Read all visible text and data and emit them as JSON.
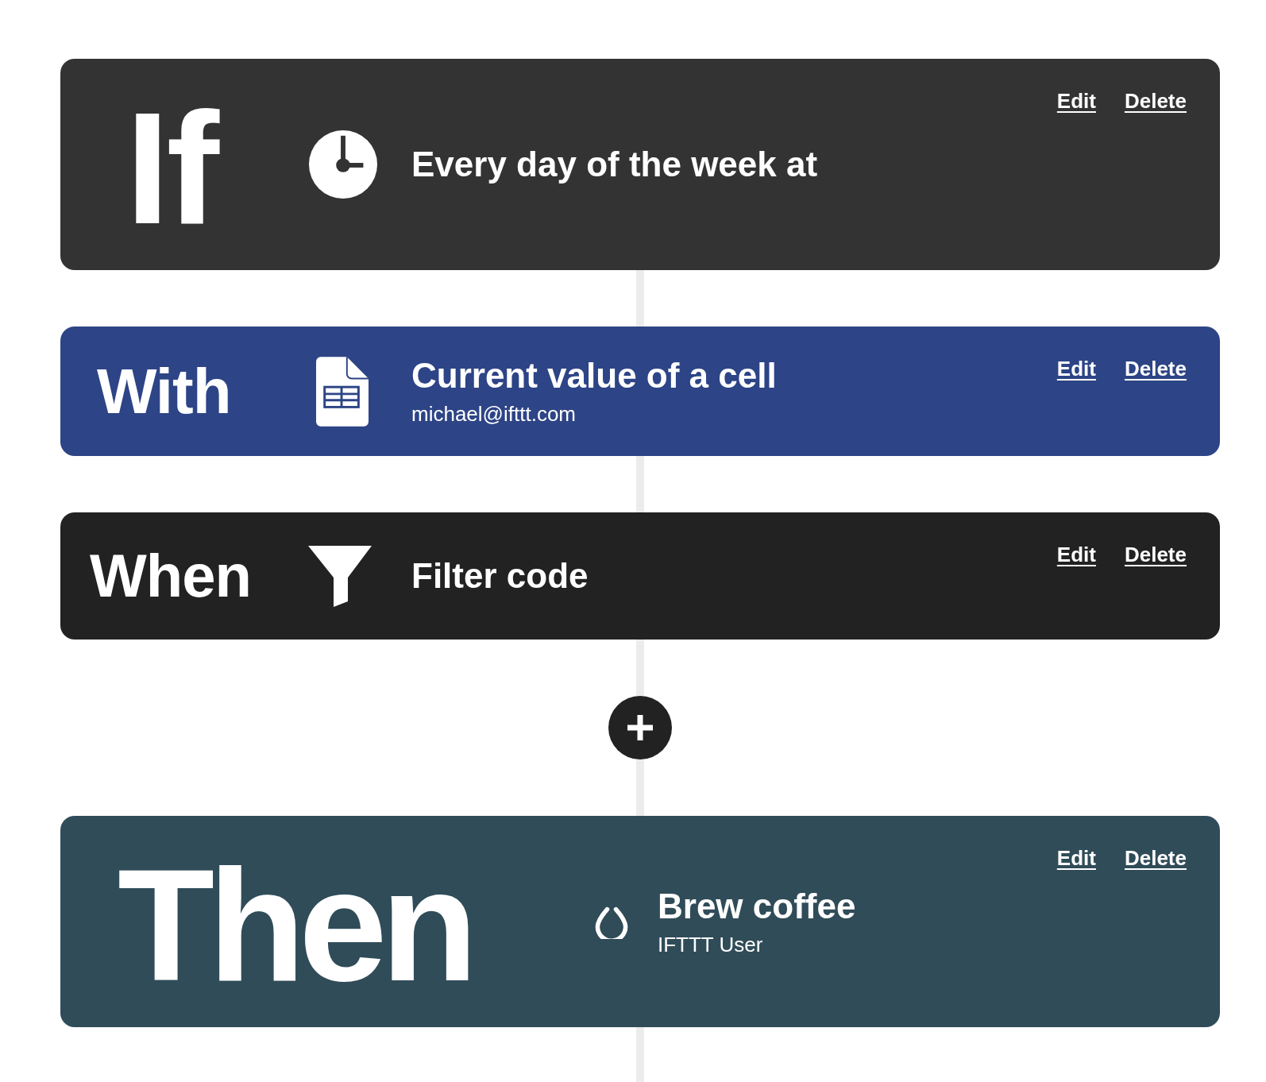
{
  "steps": [
    {
      "kind": "if",
      "label": "If",
      "title": "Every day of the week at",
      "actions": [
        "Edit",
        "Delete"
      ]
    },
    {
      "kind": "with",
      "label": "With",
      "title": "Current value of a cell",
      "subtitle": "michael@ifttt.com",
      "actions": [
        "Edit",
        "Delete"
      ]
    },
    {
      "kind": "when",
      "label": "When",
      "title": "Filter code",
      "actions": [
        "Edit",
        "Delete"
      ]
    },
    {
      "kind": "add"
    },
    {
      "kind": "then",
      "label": "Then",
      "title": "Brew coffee",
      "subtitle": "IFTTT User",
      "actions": [
        "Edit",
        "Delete"
      ]
    }
  ]
}
